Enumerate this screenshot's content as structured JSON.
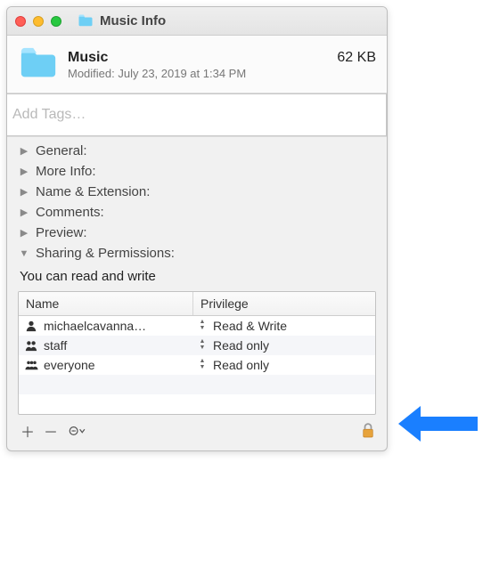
{
  "window": {
    "title": "Music Info"
  },
  "header": {
    "name": "Music",
    "size": "62 KB",
    "modified": "Modified:  July 23, 2019 at 1:34 PM"
  },
  "tags": {
    "placeholder": "Add Tags…"
  },
  "sections": {
    "general": "General:",
    "more_info": "More Info:",
    "name_ext": "Name & Extension:",
    "comments": "Comments:",
    "preview": "Preview:",
    "sharing": "Sharing & Permissions:"
  },
  "permissions": {
    "note": "You can read and write",
    "headers": {
      "name": "Name",
      "privilege": "Privilege"
    },
    "rows": [
      {
        "user": "michaelcavanna…",
        "priv": "Read & Write",
        "icon": "single"
      },
      {
        "user": "staff",
        "priv": "Read only",
        "icon": "double"
      },
      {
        "user": "everyone",
        "priv": "Read only",
        "icon": "triple"
      }
    ]
  }
}
